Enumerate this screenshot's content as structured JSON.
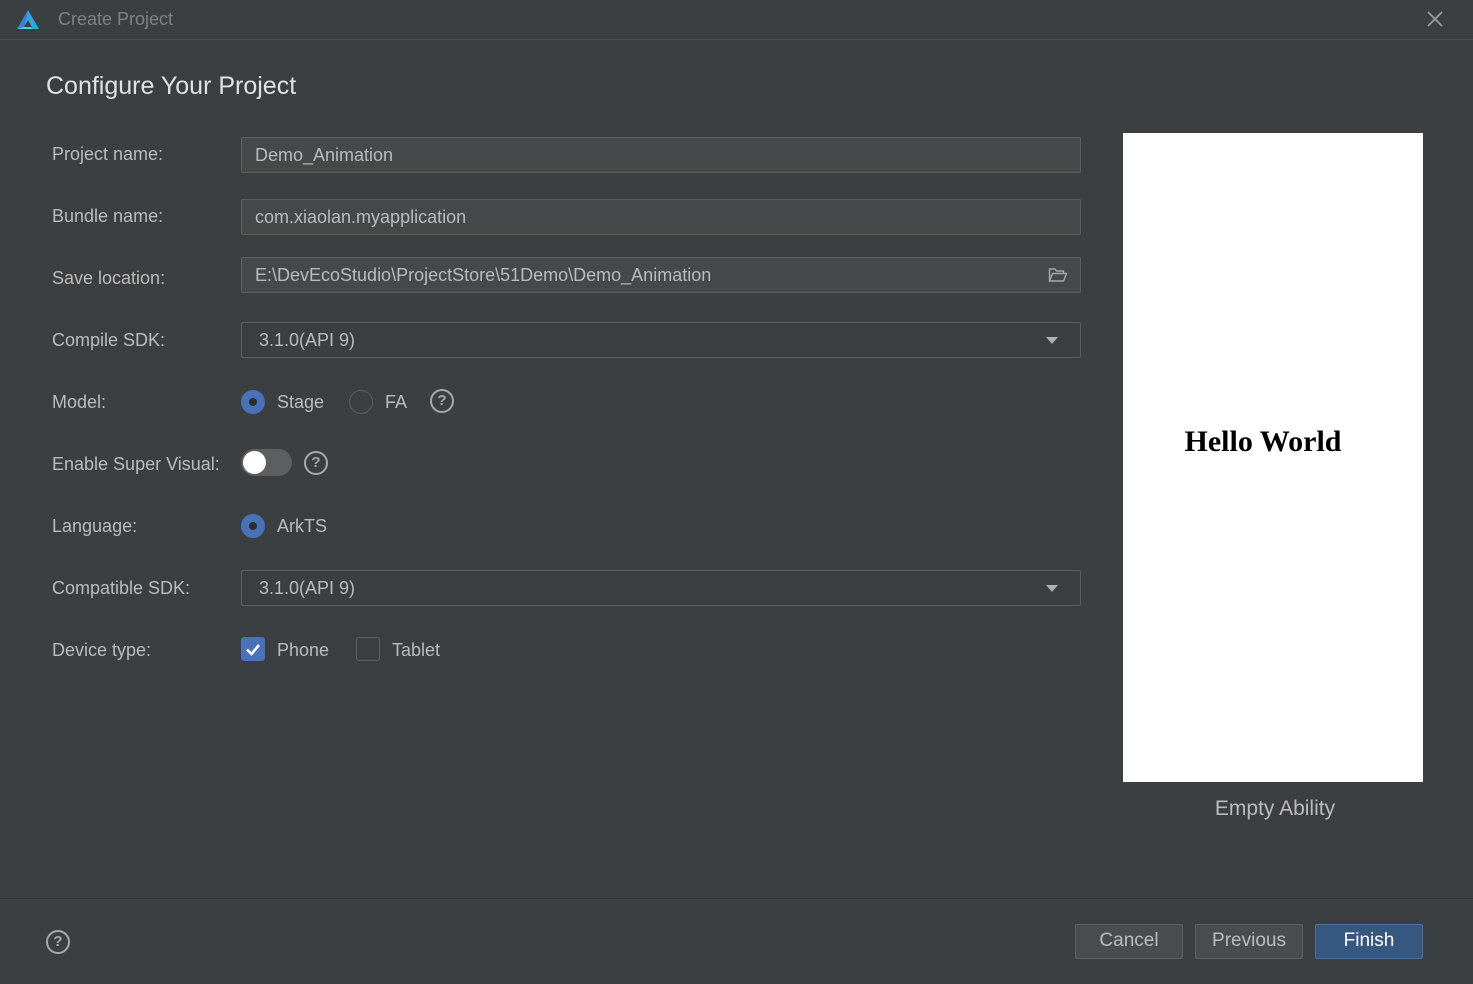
{
  "window": {
    "title": "Create Project",
    "logo_icon": "deveco-logo-icon",
    "close_icon": "close-icon"
  },
  "page": {
    "heading": "Configure Your Project"
  },
  "form": {
    "project_name": {
      "label": "Project name:",
      "value": "Demo_Animation"
    },
    "bundle_name": {
      "label": "Bundle name:",
      "value": "com.xiaolan.myapplication"
    },
    "save_location": {
      "label": "Save location:",
      "value": "E:\\DevEcoStudio\\ProjectStore\\51Demo\\Demo_Animation",
      "icon": "folder-open-icon"
    },
    "compile_sdk": {
      "label": "Compile SDK:",
      "value": "3.1.0(API 9)"
    },
    "model": {
      "label": "Model:",
      "options": [
        {
          "label": "Stage",
          "selected": true
        },
        {
          "label": "FA",
          "selected": false
        }
      ],
      "help": "?"
    },
    "super_visual": {
      "label": "Enable Super Visual:",
      "enabled": false,
      "help": "?"
    },
    "language": {
      "label": "Language:",
      "options": [
        {
          "label": "ArkTS",
          "selected": true
        }
      ]
    },
    "compatible_sdk": {
      "label": "Compatible SDK:",
      "value": "3.1.0(API 9)"
    },
    "device_type": {
      "label": "Device type:",
      "options": [
        {
          "label": "Phone",
          "checked": true
        },
        {
          "label": "Tablet",
          "checked": false
        }
      ]
    }
  },
  "preview": {
    "screen_text": "Hello World",
    "caption": "Empty Ability"
  },
  "footer": {
    "help": "?",
    "cancel_label": "Cancel",
    "previous_label": "Previous",
    "finish_label": "Finish"
  },
  "colors": {
    "background": "#3c3f41",
    "accent": "#4a72b8",
    "primary_button": "#365880"
  }
}
